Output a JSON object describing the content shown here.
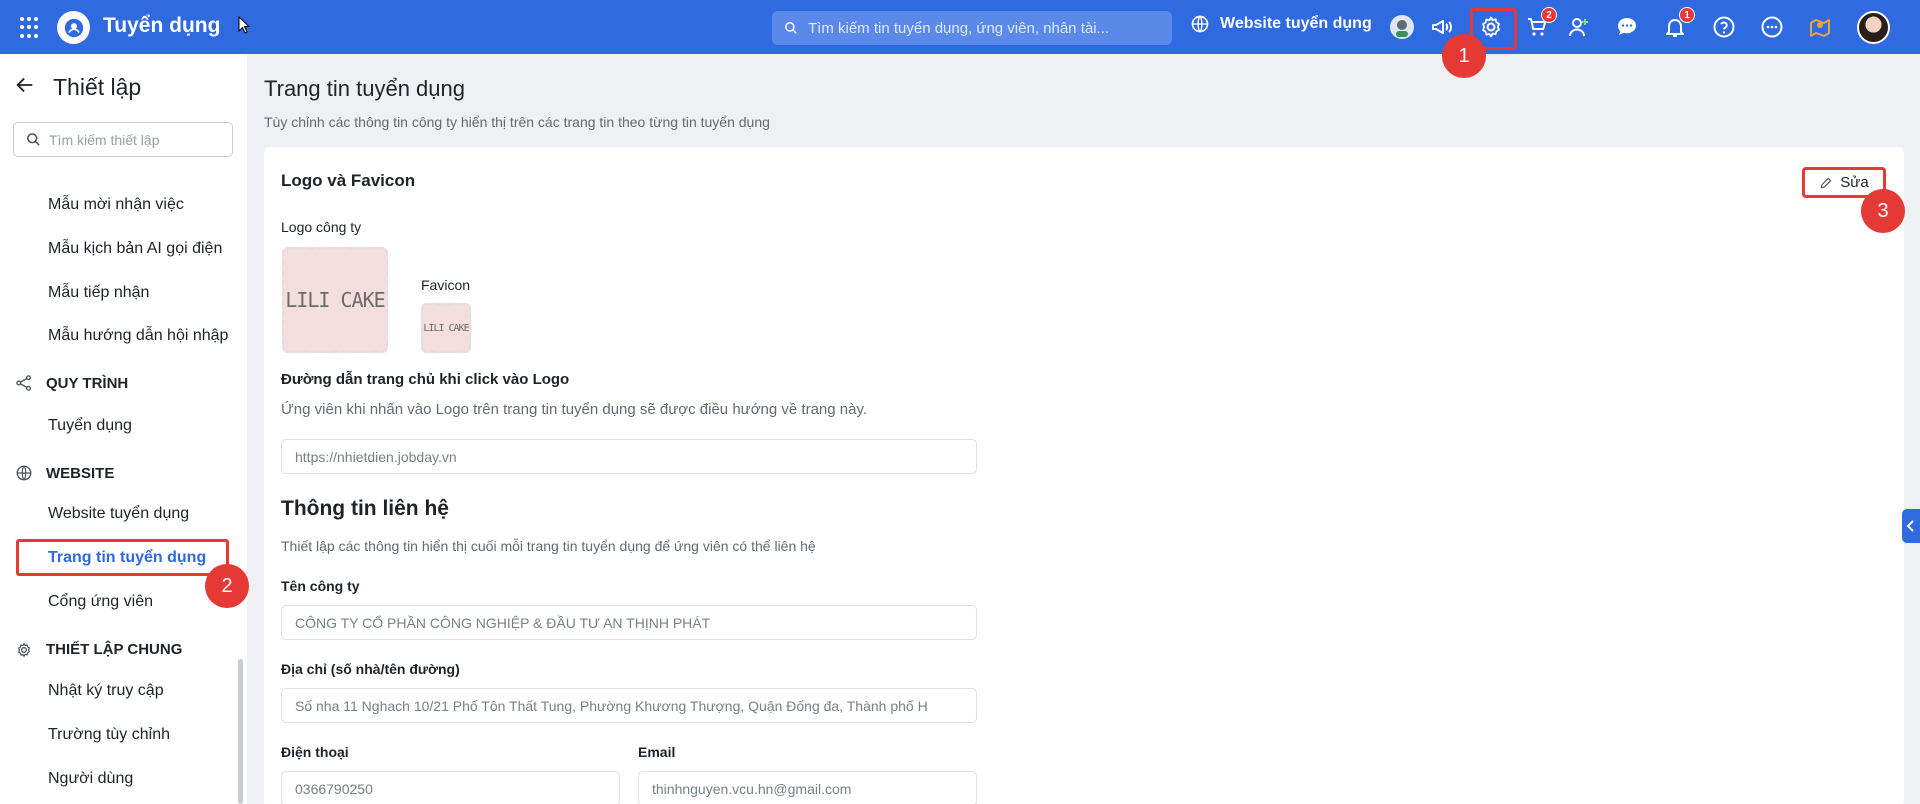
{
  "app": {
    "title": "Tuyển dụng",
    "search_placeholder": "Tìm kiếm tin tuyển dụng, ứng viên, nhân tài...",
    "website_link": "Website tuyển dụng",
    "badges": {
      "cart": "2",
      "notifications": "1"
    },
    "markers": [
      "1",
      "2",
      "3"
    ]
  },
  "sidebar": {
    "title": "Thiết lập",
    "search_placeholder": "Tìm kiếm thiết lập",
    "items_top": [
      "Mẫu mời nhận việc",
      "Mẫu kịch bản AI gọi điện",
      "Mẫu tiếp nhận",
      "Mẫu hướng dẫn hội nhập"
    ],
    "section_process": "QUY TRÌNH",
    "process_items": [
      "Tuyển dụng"
    ],
    "section_website": "WEBSITE",
    "website_items": [
      "Website tuyển dụng",
      "Trang tin tuyển dụng",
      "Cổng ứng viên"
    ],
    "section_general": "THIẾT LẬP CHUNG",
    "general_items": [
      "Nhật ký truy cập",
      "Trường tùy chỉnh",
      "Người dùng"
    ]
  },
  "main": {
    "title": "Trang tin tuyển dụng",
    "subtitle": "Tùy chỉnh các thông tin công ty hiển thị trên các trang tin theo từng tin tuyển dụng",
    "logo_section": {
      "title": "Logo và Favicon",
      "edit_label": "Sửa",
      "company_logo_label": "Logo công ty",
      "favicon_label": "Favicon",
      "logo_text": "LILI CAKE",
      "link_label": "Đường dẫn trang chủ khi click vào Logo",
      "link_desc": "Ứng viên khi nhấn vào Logo trên trang tin tuyển dụng sẽ được điều hướng về trang này.",
      "link_value": "https://nhietdien.jobday.vn"
    },
    "contact_section": {
      "title": "Thông tin liên hệ",
      "desc": "Thiết lập các thông tin hiển thị cuối mỗi trang tin tuyển dụng để ứng viên có thể liên hệ",
      "company_label": "Tên công ty",
      "company_value": "CÔNG TY CỔ PHẦN CÔNG NGHIỆP & ĐẦU TƯ AN THỊNH PHÁT",
      "address_label": "Địa chỉ (số nhà/tên đường)",
      "address_value": "Số nha 11 Nghach 10/21 Phố Tôn Thất Tung, Phường Khương Thượng, Quận Đống đa, Thành phố H",
      "phone_label": "Điện thoại",
      "phone_value": "0366790250",
      "email_label": "Email",
      "email_value": "thinhnguyen.vcu.hn@gmail.com"
    }
  },
  "colors": {
    "primary": "#2f6ae1",
    "highlight": "#e53935"
  }
}
